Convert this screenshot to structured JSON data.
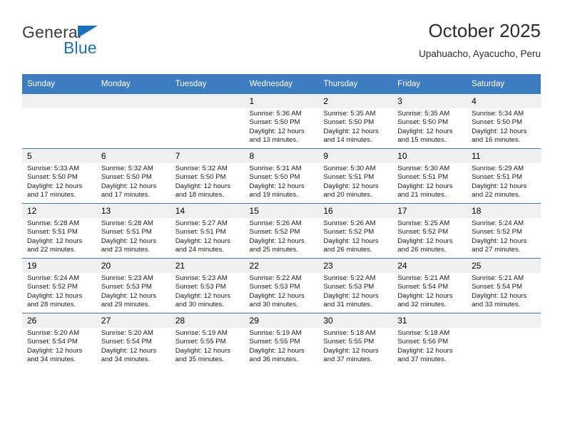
{
  "brand": {
    "name_top": "General",
    "name_bottom": "Blue",
    "triangle_color": "#1a71bb",
    "text_color": "#3c3c3c"
  },
  "header": {
    "title": "October 2025",
    "subtitle": "Upahuacho, Ayacucho, Peru"
  },
  "theme": {
    "header_blue": "#3d7cc0",
    "daynum_gray": "#f0f0f0",
    "grid_line": "#3d7cc0"
  },
  "weekdays": [
    "Sunday",
    "Monday",
    "Tuesday",
    "Wednesday",
    "Thursday",
    "Friday",
    "Saturday"
  ],
  "weeks": [
    [
      {
        "day": "",
        "sunrise": "",
        "sunset": "",
        "daylight_a": "",
        "daylight_b": ""
      },
      {
        "day": "",
        "sunrise": "",
        "sunset": "",
        "daylight_a": "",
        "daylight_b": ""
      },
      {
        "day": "",
        "sunrise": "",
        "sunset": "",
        "daylight_a": "",
        "daylight_b": ""
      },
      {
        "day": "1",
        "sunrise": "Sunrise: 5:36 AM",
        "sunset": "Sunset: 5:50 PM",
        "daylight_a": "Daylight: 12 hours",
        "daylight_b": "and 13 minutes."
      },
      {
        "day": "2",
        "sunrise": "Sunrise: 5:35 AM",
        "sunset": "Sunset: 5:50 PM",
        "daylight_a": "Daylight: 12 hours",
        "daylight_b": "and 14 minutes."
      },
      {
        "day": "3",
        "sunrise": "Sunrise: 5:35 AM",
        "sunset": "Sunset: 5:50 PM",
        "daylight_a": "Daylight: 12 hours",
        "daylight_b": "and 15 minutes."
      },
      {
        "day": "4",
        "sunrise": "Sunrise: 5:34 AM",
        "sunset": "Sunset: 5:50 PM",
        "daylight_a": "Daylight: 12 hours",
        "daylight_b": "and 16 minutes."
      }
    ],
    [
      {
        "day": "5",
        "sunrise": "Sunrise: 5:33 AM",
        "sunset": "Sunset: 5:50 PM",
        "daylight_a": "Daylight: 12 hours",
        "daylight_b": "and 17 minutes."
      },
      {
        "day": "6",
        "sunrise": "Sunrise: 5:32 AM",
        "sunset": "Sunset: 5:50 PM",
        "daylight_a": "Daylight: 12 hours",
        "daylight_b": "and 17 minutes."
      },
      {
        "day": "7",
        "sunrise": "Sunrise: 5:32 AM",
        "sunset": "Sunset: 5:50 PM",
        "daylight_a": "Daylight: 12 hours",
        "daylight_b": "and 18 minutes."
      },
      {
        "day": "8",
        "sunrise": "Sunrise: 5:31 AM",
        "sunset": "Sunset: 5:50 PM",
        "daylight_a": "Daylight: 12 hours",
        "daylight_b": "and 19 minutes."
      },
      {
        "day": "9",
        "sunrise": "Sunrise: 5:30 AM",
        "sunset": "Sunset: 5:51 PM",
        "daylight_a": "Daylight: 12 hours",
        "daylight_b": "and 20 minutes."
      },
      {
        "day": "10",
        "sunrise": "Sunrise: 5:30 AM",
        "sunset": "Sunset: 5:51 PM",
        "daylight_a": "Daylight: 12 hours",
        "daylight_b": "and 21 minutes."
      },
      {
        "day": "11",
        "sunrise": "Sunrise: 5:29 AM",
        "sunset": "Sunset: 5:51 PM",
        "daylight_a": "Daylight: 12 hours",
        "daylight_b": "and 22 minutes."
      }
    ],
    [
      {
        "day": "12",
        "sunrise": "Sunrise: 5:28 AM",
        "sunset": "Sunset: 5:51 PM",
        "daylight_a": "Daylight: 12 hours",
        "daylight_b": "and 22 minutes."
      },
      {
        "day": "13",
        "sunrise": "Sunrise: 5:28 AM",
        "sunset": "Sunset: 5:51 PM",
        "daylight_a": "Daylight: 12 hours",
        "daylight_b": "and 23 minutes."
      },
      {
        "day": "14",
        "sunrise": "Sunrise: 5:27 AM",
        "sunset": "Sunset: 5:51 PM",
        "daylight_a": "Daylight: 12 hours",
        "daylight_b": "and 24 minutes."
      },
      {
        "day": "15",
        "sunrise": "Sunrise: 5:26 AM",
        "sunset": "Sunset: 5:52 PM",
        "daylight_a": "Daylight: 12 hours",
        "daylight_b": "and 25 minutes."
      },
      {
        "day": "16",
        "sunrise": "Sunrise: 5:26 AM",
        "sunset": "Sunset: 5:52 PM",
        "daylight_a": "Daylight: 12 hours",
        "daylight_b": "and 26 minutes."
      },
      {
        "day": "17",
        "sunrise": "Sunrise: 5:25 AM",
        "sunset": "Sunset: 5:52 PM",
        "daylight_a": "Daylight: 12 hours",
        "daylight_b": "and 26 minutes."
      },
      {
        "day": "18",
        "sunrise": "Sunrise: 5:24 AM",
        "sunset": "Sunset: 5:52 PM",
        "daylight_a": "Daylight: 12 hours",
        "daylight_b": "and 27 minutes."
      }
    ],
    [
      {
        "day": "19",
        "sunrise": "Sunrise: 5:24 AM",
        "sunset": "Sunset: 5:52 PM",
        "daylight_a": "Daylight: 12 hours",
        "daylight_b": "and 28 minutes."
      },
      {
        "day": "20",
        "sunrise": "Sunrise: 5:23 AM",
        "sunset": "Sunset: 5:53 PM",
        "daylight_a": "Daylight: 12 hours",
        "daylight_b": "and 29 minutes."
      },
      {
        "day": "21",
        "sunrise": "Sunrise: 5:23 AM",
        "sunset": "Sunset: 5:53 PM",
        "daylight_a": "Daylight: 12 hours",
        "daylight_b": "and 30 minutes."
      },
      {
        "day": "22",
        "sunrise": "Sunrise: 5:22 AM",
        "sunset": "Sunset: 5:53 PM",
        "daylight_a": "Daylight: 12 hours",
        "daylight_b": "and 30 minutes."
      },
      {
        "day": "23",
        "sunrise": "Sunrise: 5:22 AM",
        "sunset": "Sunset: 5:53 PM",
        "daylight_a": "Daylight: 12 hours",
        "daylight_b": "and 31 minutes."
      },
      {
        "day": "24",
        "sunrise": "Sunrise: 5:21 AM",
        "sunset": "Sunset: 5:54 PM",
        "daylight_a": "Daylight: 12 hours",
        "daylight_b": "and 32 minutes."
      },
      {
        "day": "25",
        "sunrise": "Sunrise: 5:21 AM",
        "sunset": "Sunset: 5:54 PM",
        "daylight_a": "Daylight: 12 hours",
        "daylight_b": "and 33 minutes."
      }
    ],
    [
      {
        "day": "26",
        "sunrise": "Sunrise: 5:20 AM",
        "sunset": "Sunset: 5:54 PM",
        "daylight_a": "Daylight: 12 hours",
        "daylight_b": "and 34 minutes."
      },
      {
        "day": "27",
        "sunrise": "Sunrise: 5:20 AM",
        "sunset": "Sunset: 5:54 PM",
        "daylight_a": "Daylight: 12 hours",
        "daylight_b": "and 34 minutes."
      },
      {
        "day": "28",
        "sunrise": "Sunrise: 5:19 AM",
        "sunset": "Sunset: 5:55 PM",
        "daylight_a": "Daylight: 12 hours",
        "daylight_b": "and 35 minutes."
      },
      {
        "day": "29",
        "sunrise": "Sunrise: 5:19 AM",
        "sunset": "Sunset: 5:55 PM",
        "daylight_a": "Daylight: 12 hours",
        "daylight_b": "and 36 minutes."
      },
      {
        "day": "30",
        "sunrise": "Sunrise: 5:18 AM",
        "sunset": "Sunset: 5:55 PM",
        "daylight_a": "Daylight: 12 hours",
        "daylight_b": "and 37 minutes."
      },
      {
        "day": "31",
        "sunrise": "Sunrise: 5:18 AM",
        "sunset": "Sunset: 5:56 PM",
        "daylight_a": "Daylight: 12 hours",
        "daylight_b": "and 37 minutes."
      },
      {
        "day": "",
        "sunrise": "",
        "sunset": "",
        "daylight_a": "",
        "daylight_b": ""
      }
    ]
  ]
}
